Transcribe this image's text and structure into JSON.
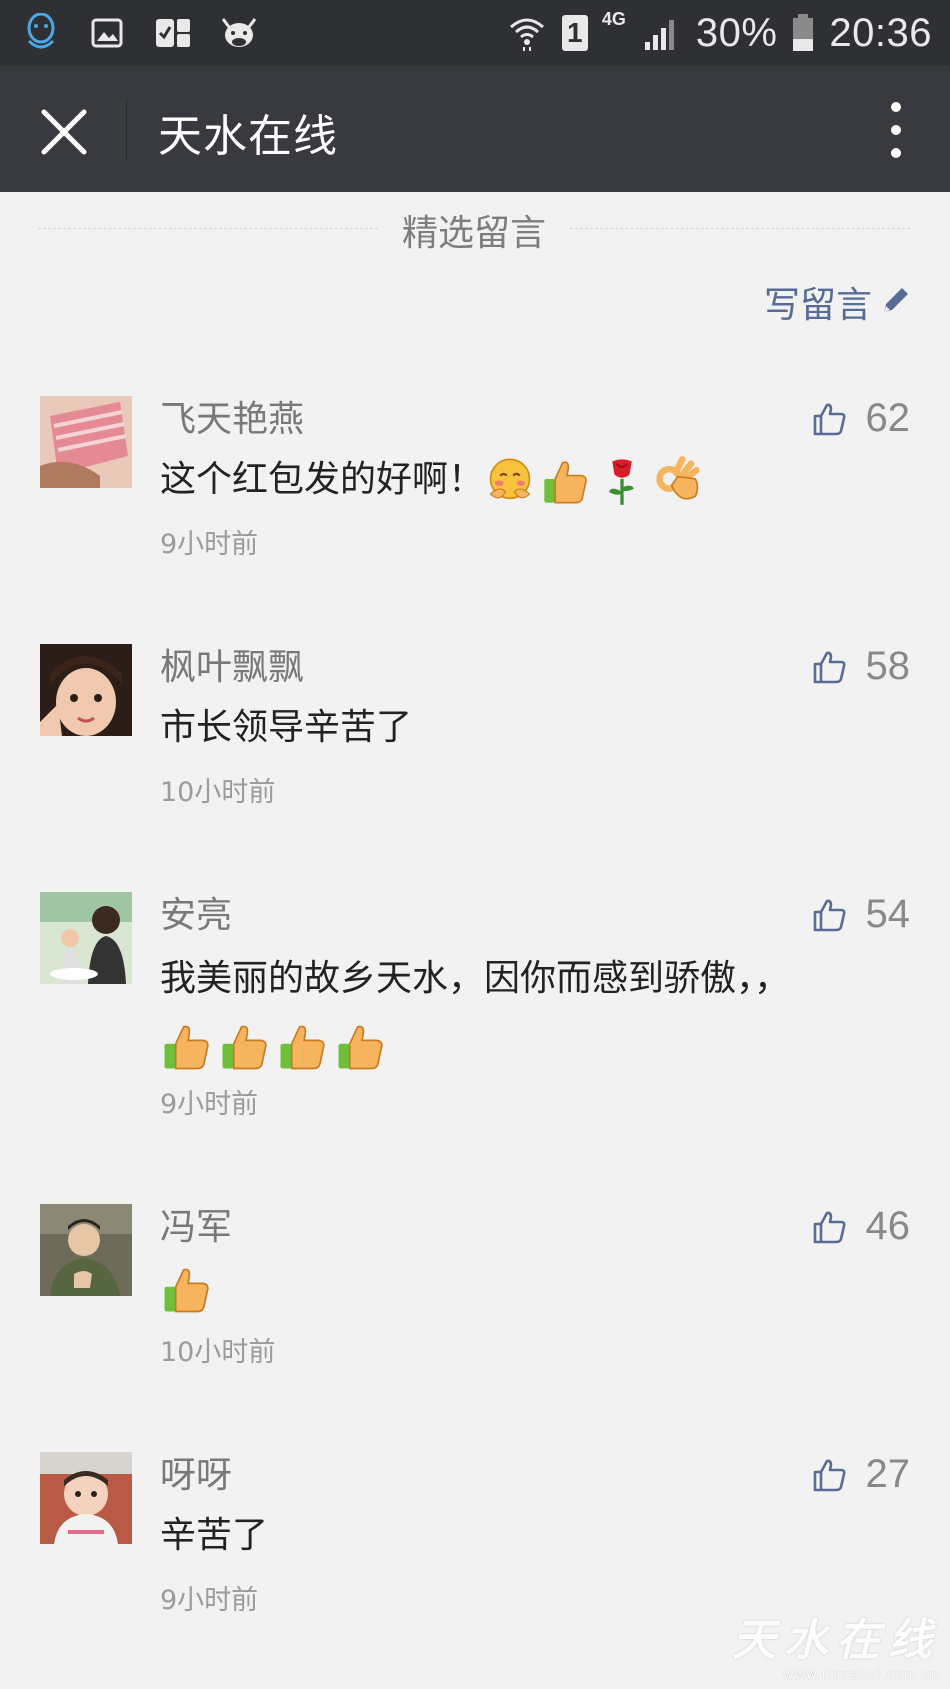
{
  "status_bar": {
    "battery": "30%",
    "time": "20:36",
    "network": "4G",
    "sim": "1",
    "icons": [
      "qq-icon",
      "image-icon",
      "clipboard-icon",
      "cow-icon",
      "wifi-icon",
      "sim-icon",
      "signal-icon",
      "battery-icon"
    ]
  },
  "nav": {
    "title": "天水在线",
    "close_icon": "close-icon",
    "more_icon": "more-icon"
  },
  "section": {
    "title": "精选留言",
    "write_label": "写留言",
    "write_icon": "pencil-icon"
  },
  "comments": [
    {
      "name": "飞天艳燕",
      "text": "这个红包发的好啊！",
      "emojis": [
        "hug",
        "thumbs-up",
        "rose",
        "ok-hand"
      ],
      "time": "9小时前",
      "likes": "62"
    },
    {
      "name": "枫叶飘飘",
      "text": "市长领导辛苦了",
      "emojis": [],
      "time": "10小时前",
      "likes": "58"
    },
    {
      "name": "安亮",
      "text": "我美丽的故乡天水，因你而感到骄傲，，",
      "emojis": [
        "thumbs-up",
        "thumbs-up",
        "thumbs-up",
        "thumbs-up"
      ],
      "time": "9小时前",
      "likes": "54"
    },
    {
      "name": "冯军",
      "text": "",
      "emojis": [
        "thumbs-up"
      ],
      "time": "10小时前",
      "likes": "46"
    },
    {
      "name": "呀呀",
      "text": "辛苦了",
      "emojis": [],
      "time": "9小时前",
      "likes": "27"
    }
  ],
  "colors": {
    "status_bg": "#2e3034",
    "nav_bg": "#393a3f",
    "page_bg": "#f2f2f2",
    "link": "#576b95",
    "like_icon": "#576b95"
  },
  "watermark": {
    "text": "天水在线",
    "url": "www.tianshui.com.cn"
  }
}
